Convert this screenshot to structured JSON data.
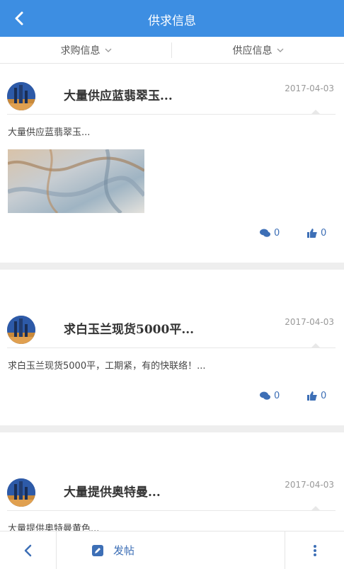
{
  "header": {
    "title": "供求信息",
    "back_icon": "chevron-left-icon"
  },
  "filters": [
    {
      "label": "求购信息",
      "icon": "chevron-down-icon"
    },
    {
      "label": "供应信息",
      "icon": "chevron-down-icon"
    }
  ],
  "posts": [
    {
      "title": "大量供应蓝翡翠玉...",
      "date": "2017-04-03",
      "excerpt": "大量供应蓝翡翠玉...",
      "has_image": true,
      "comments": "0",
      "likes": "0"
    },
    {
      "title": "求白玉兰现货5000平...",
      "date": "2017-04-03",
      "excerpt": "求白玉兰现货5000平，工期紧，有的快联络！...",
      "has_image": false,
      "comments": "0",
      "likes": "0"
    },
    {
      "title": "大量提供奥特曼...",
      "date": "2017-04-03",
      "excerpt": "大量提供奥特曼黄色...",
      "has_image": true,
      "comments": "",
      "likes": ""
    }
  ],
  "bottom_bar": {
    "post_label": "发帖",
    "post_icon": "edit-icon",
    "back_icon": "chevron-left-icon",
    "more_icon": "more-vertical-icon"
  },
  "colors": {
    "header_bg": "#3d8ee2",
    "accent": "#3d6fb6",
    "separator": "#eeeeee"
  }
}
